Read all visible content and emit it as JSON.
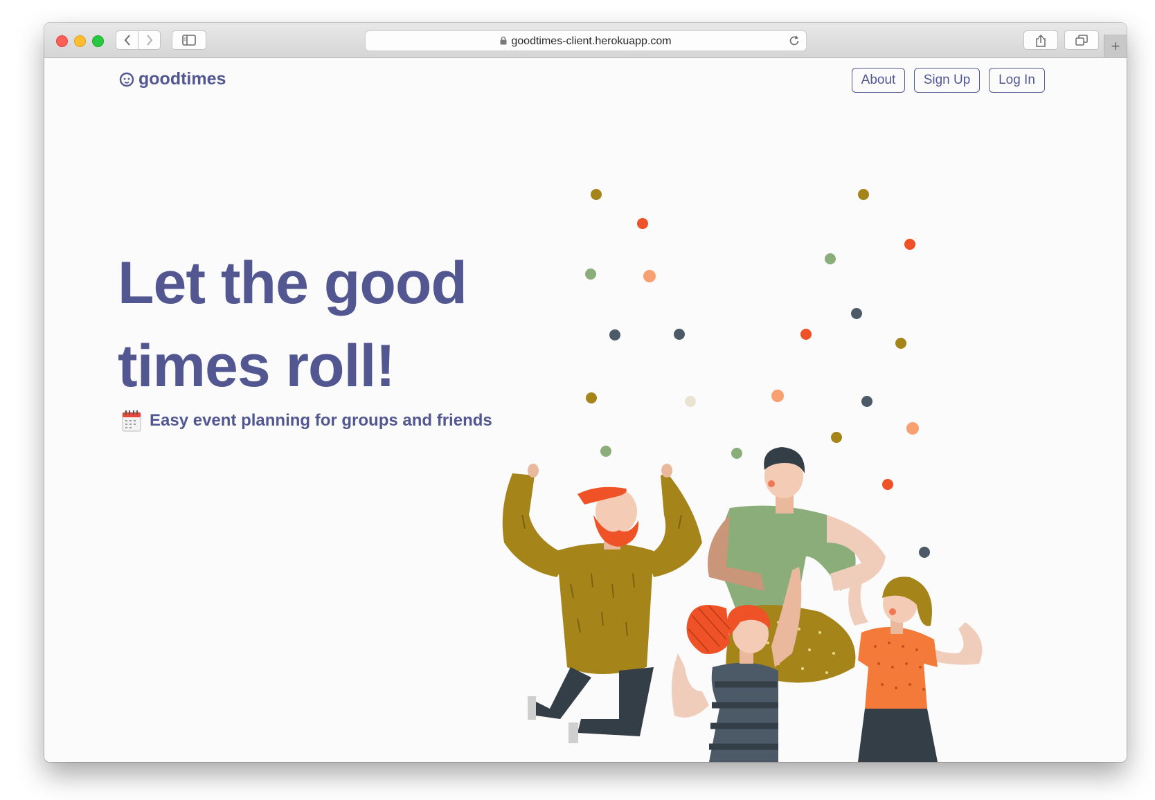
{
  "browser": {
    "url": "goodtimes-client.herokuapp.com",
    "new_tab_symbol": "+",
    "icons": [
      "back-icon",
      "forward-icon",
      "sidebar-icon",
      "lock-icon",
      "reload-icon",
      "share-icon",
      "tabs-icon"
    ]
  },
  "header": {
    "brand": "goodtimes",
    "brand_icon": "smiley-icon",
    "nav": [
      {
        "label": "About"
      },
      {
        "label": "Sign Up"
      },
      {
        "label": "Log In"
      }
    ]
  },
  "hero": {
    "headline_line1": "Let the good",
    "headline_line2": "times roll!",
    "subtitle": "Easy event planning for groups and friends",
    "subtitle_icon": "calendar-icon",
    "illustration": "dancing-friends-illustration"
  },
  "colors": {
    "brand": "#525791",
    "background": "#fbfbfb",
    "confetti_olive": "#a5851a",
    "confetti_red": "#ee5226",
    "confetti_green": "#8aad7a",
    "confetti_peach": "#f9a070",
    "confetti_slate": "#4b5a66",
    "confetti_cream": "#e9e4d2"
  }
}
